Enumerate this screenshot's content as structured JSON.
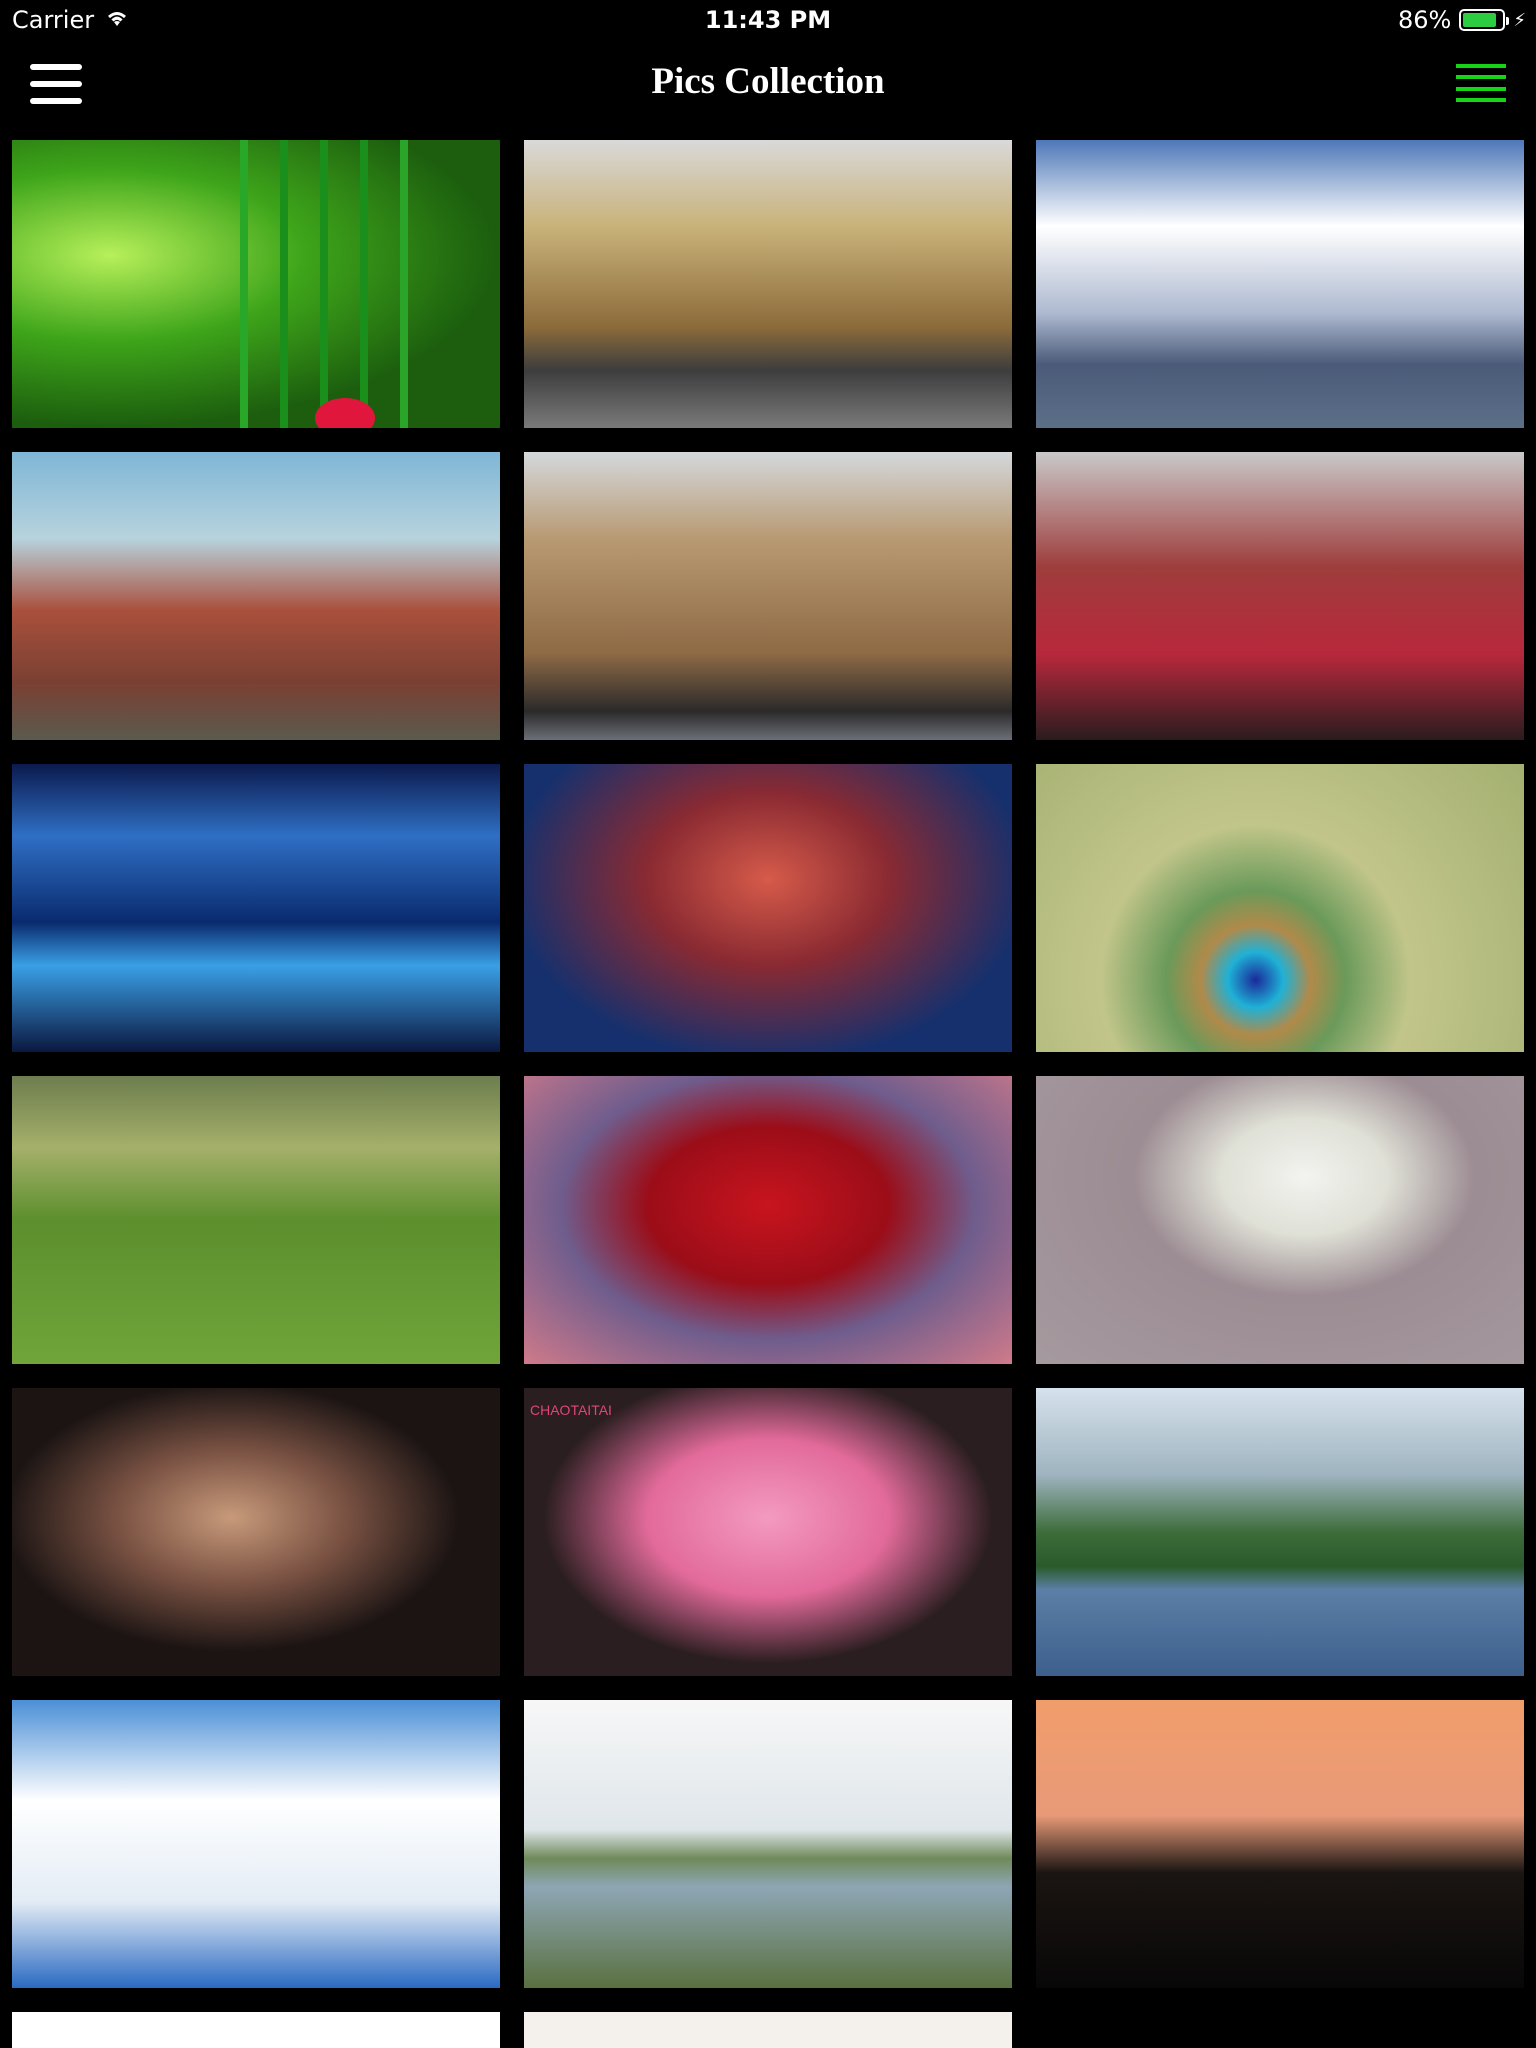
{
  "status_bar": {
    "carrier": "Carrier",
    "time": "11:43 PM",
    "battery_percent": "86%",
    "battery_level": 0.86,
    "wifi_icon": "wifi-icon",
    "charging_icon": "bolt-icon"
  },
  "nav": {
    "title": "Pics Collection",
    "left_icon": "hamburger-menu-icon",
    "right_icon": "hamburger-menu-icon",
    "right_icon_color": "#17d417"
  },
  "gallery": {
    "tile_overlay_texts": {
      "bouquet_logo": "CHAOTAITAI"
    }
  }
}
